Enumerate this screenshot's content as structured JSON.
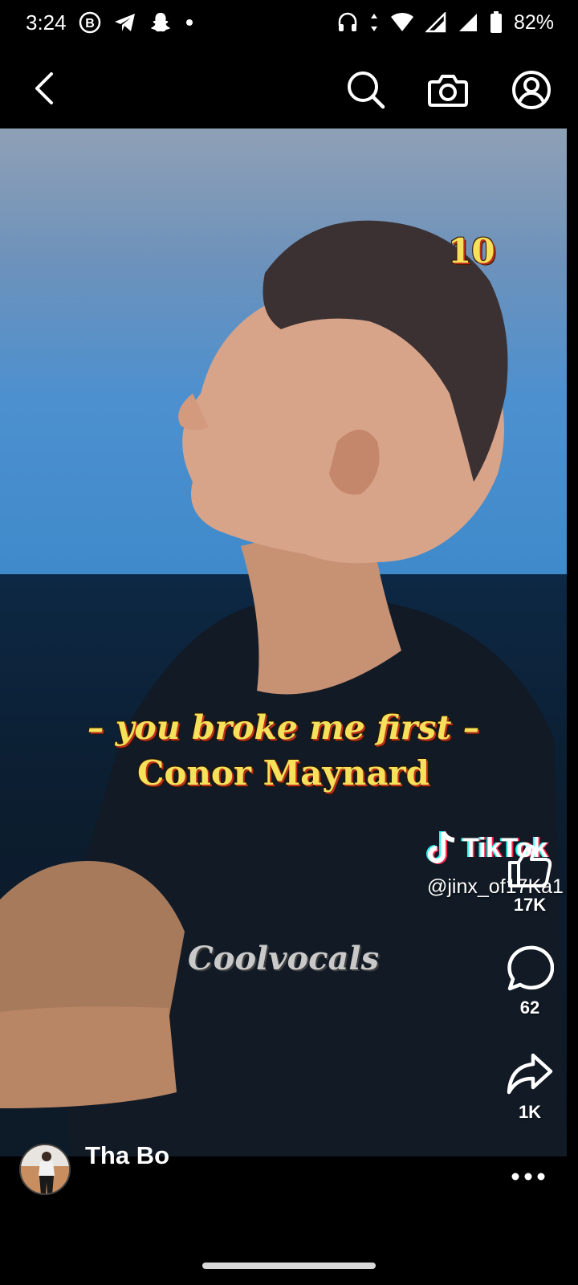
{
  "status_bar": {
    "time": "3:24",
    "battery_percent": "82%",
    "icons": [
      "b-notification-icon",
      "telegram-icon",
      "snapchat-icon",
      "dot-icon",
      "headphones-icon",
      "data-arrows-icon",
      "wifi-icon",
      "signal-icon",
      "signal-icon",
      "battery-icon"
    ]
  },
  "app_bar": {
    "icons": [
      "back-arrow-icon",
      "search-icon",
      "camera-icon",
      "profile-icon"
    ]
  },
  "video": {
    "rank_number": "10",
    "caption_song": "– you broke me first –",
    "caption_artist": "Conor Maynard",
    "watermark": "Coolvocals",
    "tiktok_wordmark": "TikTok",
    "tiktok_handle": "@jinx_of17Ka1"
  },
  "actions": {
    "like_count": "17K",
    "comment_count": "62",
    "share_count": "1K"
  },
  "post": {
    "author_name": "Tha Bo"
  },
  "colors": {
    "caption_yellow": "#f5e15a",
    "caption_shadow": "#c0301f",
    "background": "#000000",
    "icon": "#ffffff"
  }
}
